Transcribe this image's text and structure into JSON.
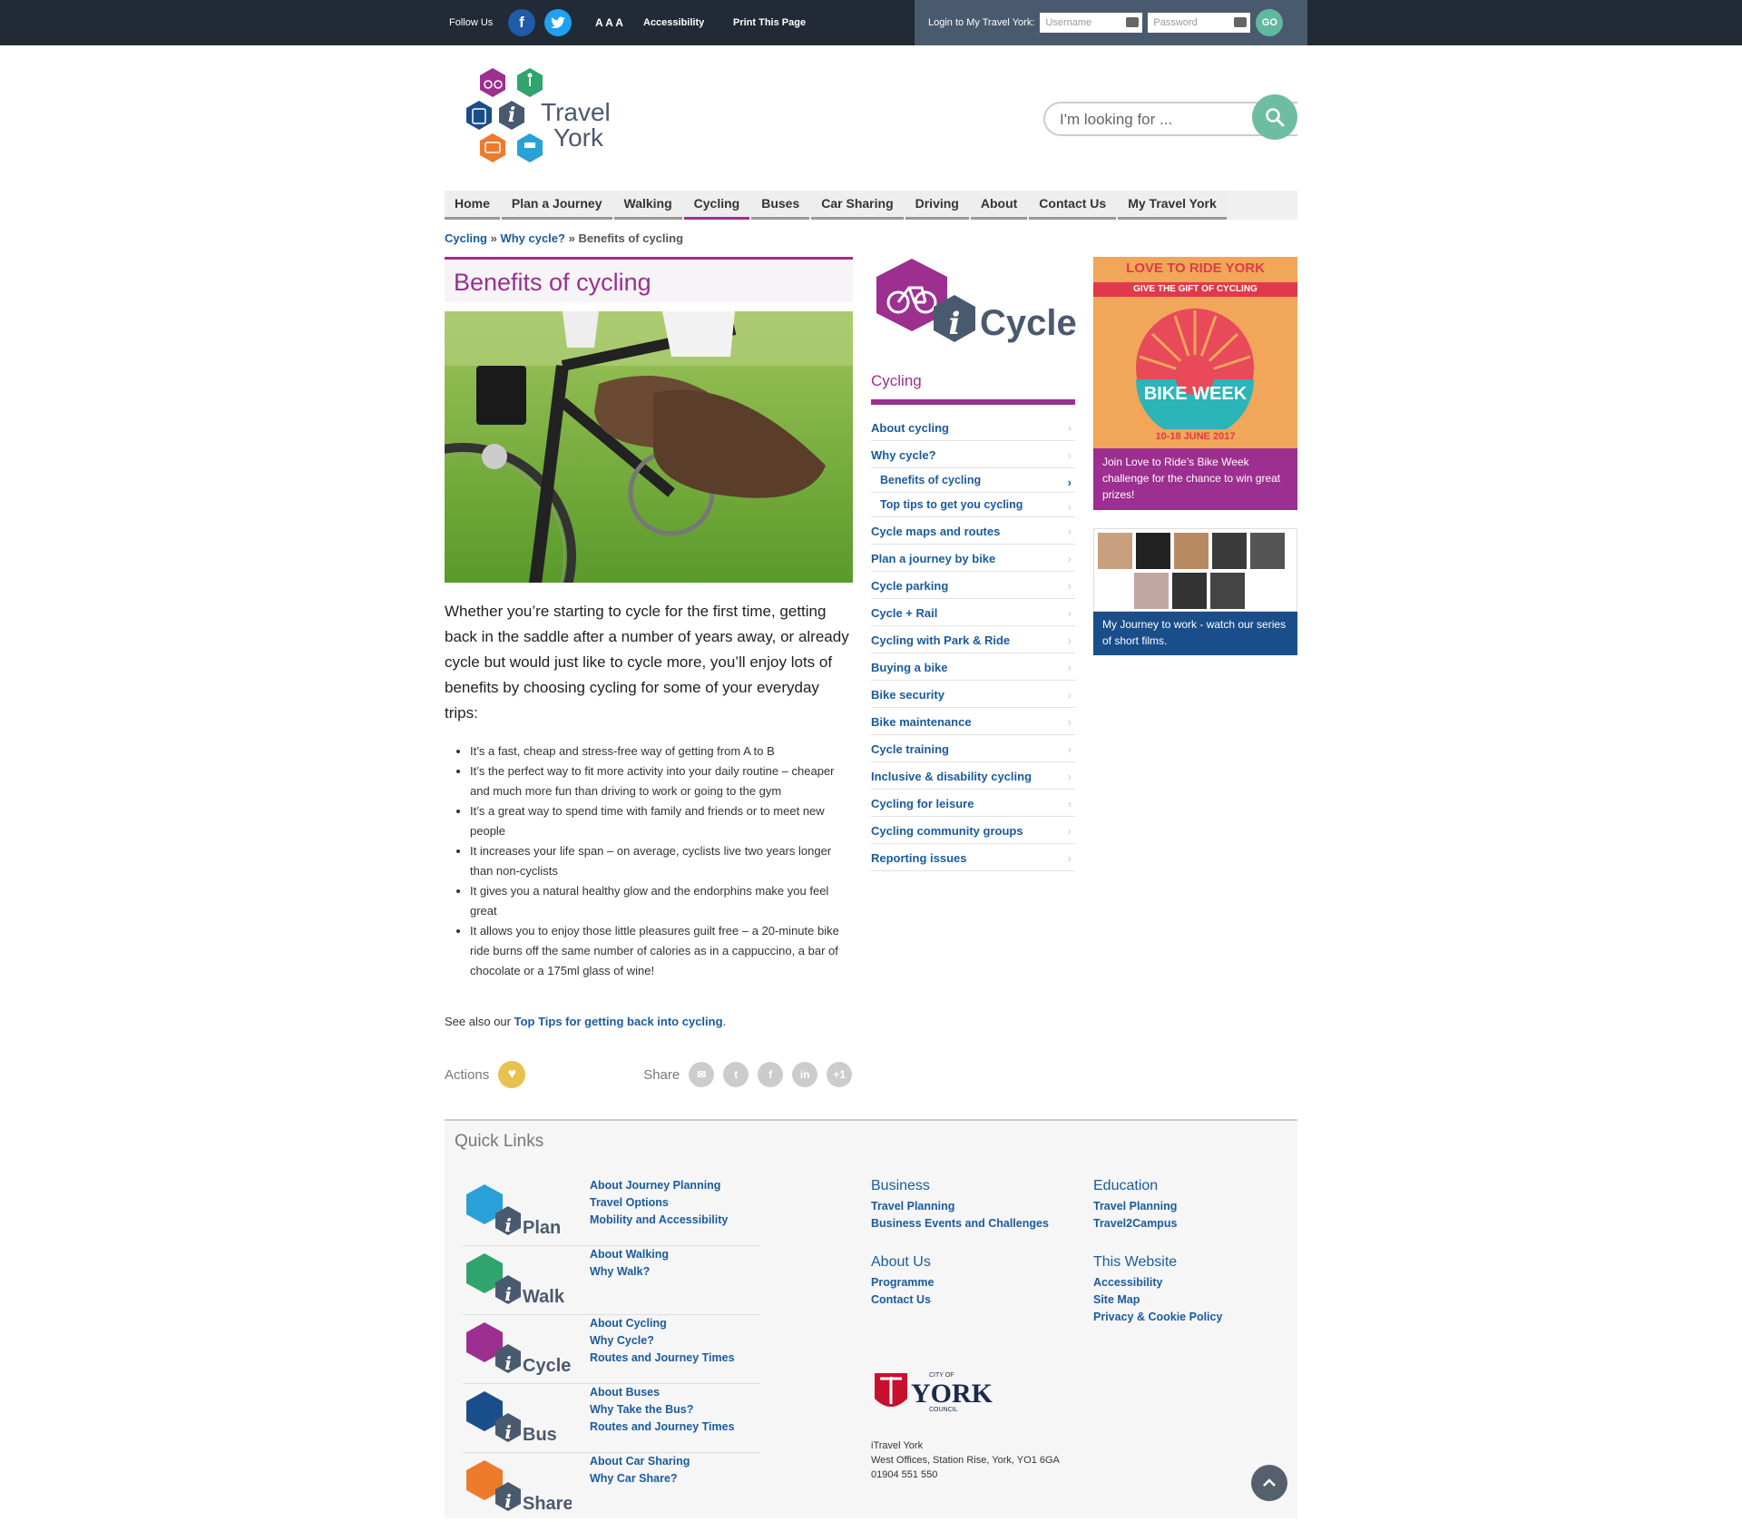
{
  "topbar": {
    "follow_us": "Follow Us",
    "text_size": "A A A",
    "accessibility": "Accessibility",
    "print": "Print This Page",
    "login_label": "Login to My Travel York:",
    "username_placeholder": "Username",
    "password_placeholder": "Password",
    "go": "GO"
  },
  "logo": {
    "line1": "Travel",
    "line2": "York",
    "i": "i"
  },
  "search": {
    "placeholder": "I'm looking for ..."
  },
  "nav": [
    "Home",
    "Plan a Journey",
    "Walking",
    "Cycling",
    "Buses",
    "Car Sharing",
    "Driving",
    "About",
    "Contact Us",
    "My Travel York"
  ],
  "nav_active": "Cycling",
  "breadcrumb": {
    "a": "Cycling",
    "sep1": " » ",
    "b": "Why cycle?",
    "sep2": " » ",
    "c": "Benefits of cycling"
  },
  "page": {
    "title": "Benefits of cycling",
    "intro": "Whether you’re starting to cycle for the first time, getting back in the saddle after a number of years away, or already cycle but would just like to cycle more, you’ll enjoy lots of benefits by choosing cycling for some of your everyday trips:",
    "benefits": [
      "It’s a fast, cheap and stress-free way of getting from A to B",
      "It’s the perfect way to fit more activity into your daily routine – cheaper and much more fun than driving to work or going to the gym",
      "It’s a great way to spend time with family and friends or to meet new people",
      "It increases your life span – on average, cyclists live two years longer than non-cyclists",
      "It gives you a natural healthy glow and the endorphins make you feel great",
      "It allows you to enjoy those little pleasures guilt free – a 20-minute bike ride burns off the same number of calories as in a cappuccino, a bar of chocolate or a 175ml glass of wine!"
    ],
    "see_also_prefix": "See also our ",
    "see_also_link": "Top Tips for getting back into cycling",
    "see_also_suffix": ".",
    "actions": "Actions",
    "share": "Share",
    "share_plus": "+1",
    "share_in": "in"
  },
  "sidebar": {
    "logo_word": "Cycle",
    "heading": "Cycling",
    "items": [
      {
        "label": "About cycling",
        "sub": false
      },
      {
        "label": "Why cycle?",
        "sub": false
      },
      {
        "label": "Benefits of cycling",
        "sub": true,
        "current": true
      },
      {
        "label": "Top tips to get you cycling",
        "sub": true
      },
      {
        "label": "Cycle maps and routes",
        "sub": false
      },
      {
        "label": "Plan a journey by bike",
        "sub": false
      },
      {
        "label": "Cycle parking",
        "sub": false
      },
      {
        "label": "Cycle + Rail",
        "sub": false
      },
      {
        "label": "Cycling with Park & Ride",
        "sub": false
      },
      {
        "label": "Buying a bike",
        "sub": false
      },
      {
        "label": "Bike security",
        "sub": false
      },
      {
        "label": "Bike maintenance",
        "sub": false
      },
      {
        "label": "Cycle training",
        "sub": false
      },
      {
        "label": "Inclusive & disability cycling",
        "sub": false
      },
      {
        "label": "Cycling for leisure",
        "sub": false
      },
      {
        "label": "Cycling community groups",
        "sub": false
      },
      {
        "label": "Reporting issues",
        "sub": false
      }
    ]
  },
  "banners": {
    "bikeweek": {
      "title": "LOVE TO RIDE YORK",
      "strap": "GIVE THE GIFT OF CYCLING",
      "badge": "BIKE WEEK",
      "dates": "10-18 JUNE 2017",
      "caption": "Join Love to Ride’s Bike Week challenge for the chance to win great prizes!"
    },
    "journey": {
      "caption": "My Journey to work - watch our series of short films."
    }
  },
  "quick_links": {
    "heading": "Quick Links",
    "groups": [
      {
        "logo": "Plan",
        "links": [
          "About Journey Planning",
          "Travel Options",
          "Mobility and Accessibility"
        ]
      },
      {
        "logo": "Walk",
        "links": [
          "About Walking",
          "Why Walk?"
        ]
      },
      {
        "logo": "Cycle",
        "links": [
          "About Cycling",
          "Why Cycle?",
          "Routes and Journey Times"
        ]
      },
      {
        "logo": "Bus",
        "links": [
          "About Buses",
          "Why Take the Bus?",
          "Routes and Journey Times"
        ]
      },
      {
        "logo": "Share",
        "links": [
          "About Car Sharing",
          "Why Car Share?"
        ]
      }
    ],
    "business": {
      "title": "Business",
      "links": [
        "Travel Planning",
        "Business Events and Challenges"
      ]
    },
    "education": {
      "title": "Education",
      "links": [
        "Travel Planning",
        "Travel2Campus"
      ]
    },
    "about": {
      "title": "About Us",
      "links": [
        "Programme",
        "Contact Us"
      ]
    },
    "website": {
      "title": "This Website",
      "links": [
        "Accessibility",
        "Site Map",
        "Privacy & Cookie Policy"
      ]
    },
    "council": {
      "small1": "CITY OF",
      "name": "YORK",
      "small2": "COUNCIL"
    },
    "address": [
      "iTravel York",
      "West Offices, Station Rise, York, YO1 6GA",
      "01904 551 550"
    ],
    "to_top": "^"
  },
  "colors": {
    "brand_purple": "#9c2f8f",
    "link_blue": "#1a5b9c",
    "topbar": "#222a35",
    "green": "#6fbda0"
  }
}
